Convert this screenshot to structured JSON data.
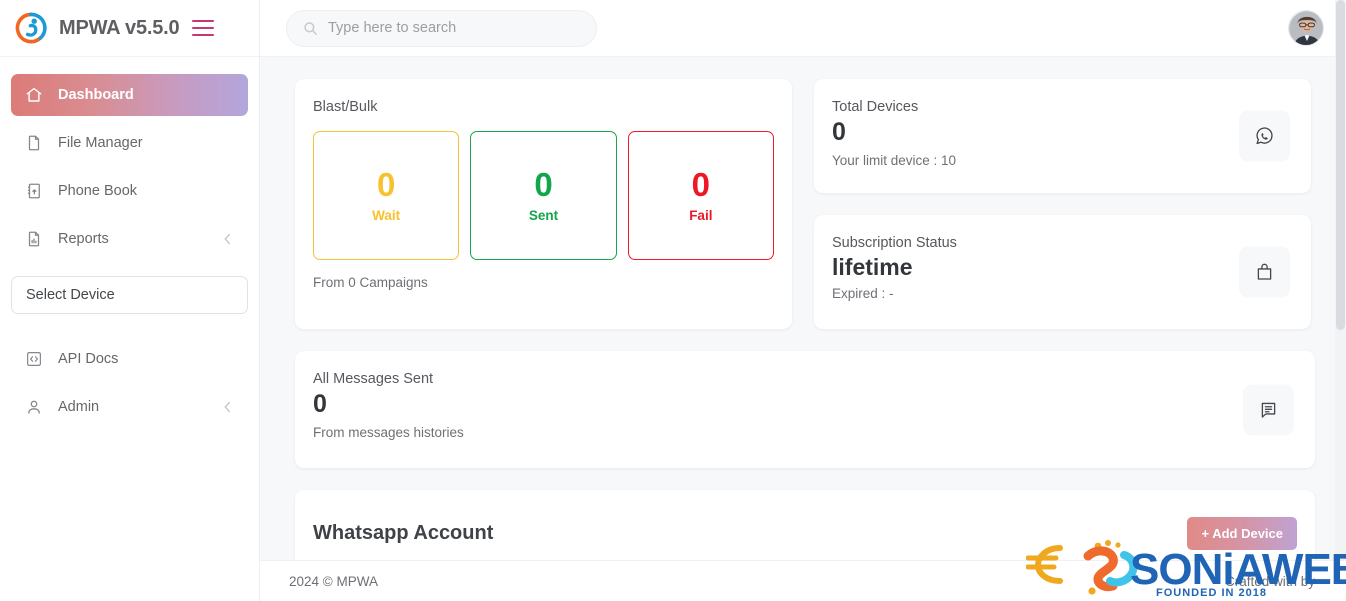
{
  "brand": {
    "title": "MPWA v5.5.0",
    "logo_icon": "swirl-logo-icon",
    "menu_icon": "hamburger-menu-icon"
  },
  "sidebar": {
    "items": [
      {
        "label": "Dashboard",
        "icon": "home-icon",
        "active": true,
        "chevron": false
      },
      {
        "label": "File Manager",
        "icon": "file-icon",
        "active": false,
        "chevron": false
      },
      {
        "label": "Phone Book",
        "icon": "phone-book-icon",
        "active": false,
        "chevron": false
      },
      {
        "label": "Reports",
        "icon": "bar-chart-doc-icon",
        "active": false,
        "chevron": true
      }
    ],
    "device_select": {
      "label": "Select Device"
    },
    "lower_items": [
      {
        "label": "API Docs",
        "icon": "code-brackets-icon",
        "chevron": false
      },
      {
        "label": "Admin",
        "icon": "user-icon",
        "chevron": true
      }
    ]
  },
  "topbar": {
    "search": {
      "placeholder": "Type here to search",
      "value": "",
      "icon": "search-icon"
    },
    "avatar": "user-avatar"
  },
  "blast_card": {
    "title": "Blast/Bulk",
    "stats": [
      {
        "value": "0",
        "label": "Wait",
        "color": "#f7c12f"
      },
      {
        "value": "0",
        "label": "Sent",
        "color": "#12a64a"
      },
      {
        "value": "0",
        "label": "Fail",
        "color": "#ee1726"
      }
    ],
    "footer": "From 0 Campaigns"
  },
  "total_devices": {
    "label": "Total Devices",
    "value": "0",
    "sub": "Your limit device : 10",
    "icon": "whatsapp-icon"
  },
  "subscription": {
    "label": "Subscription Status",
    "value": "lifetime",
    "sub": "Expired : -",
    "icon": "shopping-bag-icon"
  },
  "all_messages": {
    "label": "All Messages Sent",
    "value": "0",
    "sub": "From messages histories",
    "icon": "message-lines-icon"
  },
  "whatsapp_account": {
    "title": "Whatsapp Account",
    "add_device_label": "+  Add Device"
  },
  "footer": {
    "left": "2024 © MPWA",
    "right": "Crafted with by"
  },
  "watermark": {
    "name": "SONIAWEB",
    "tagline": "FOUNDED IN 2018"
  }
}
